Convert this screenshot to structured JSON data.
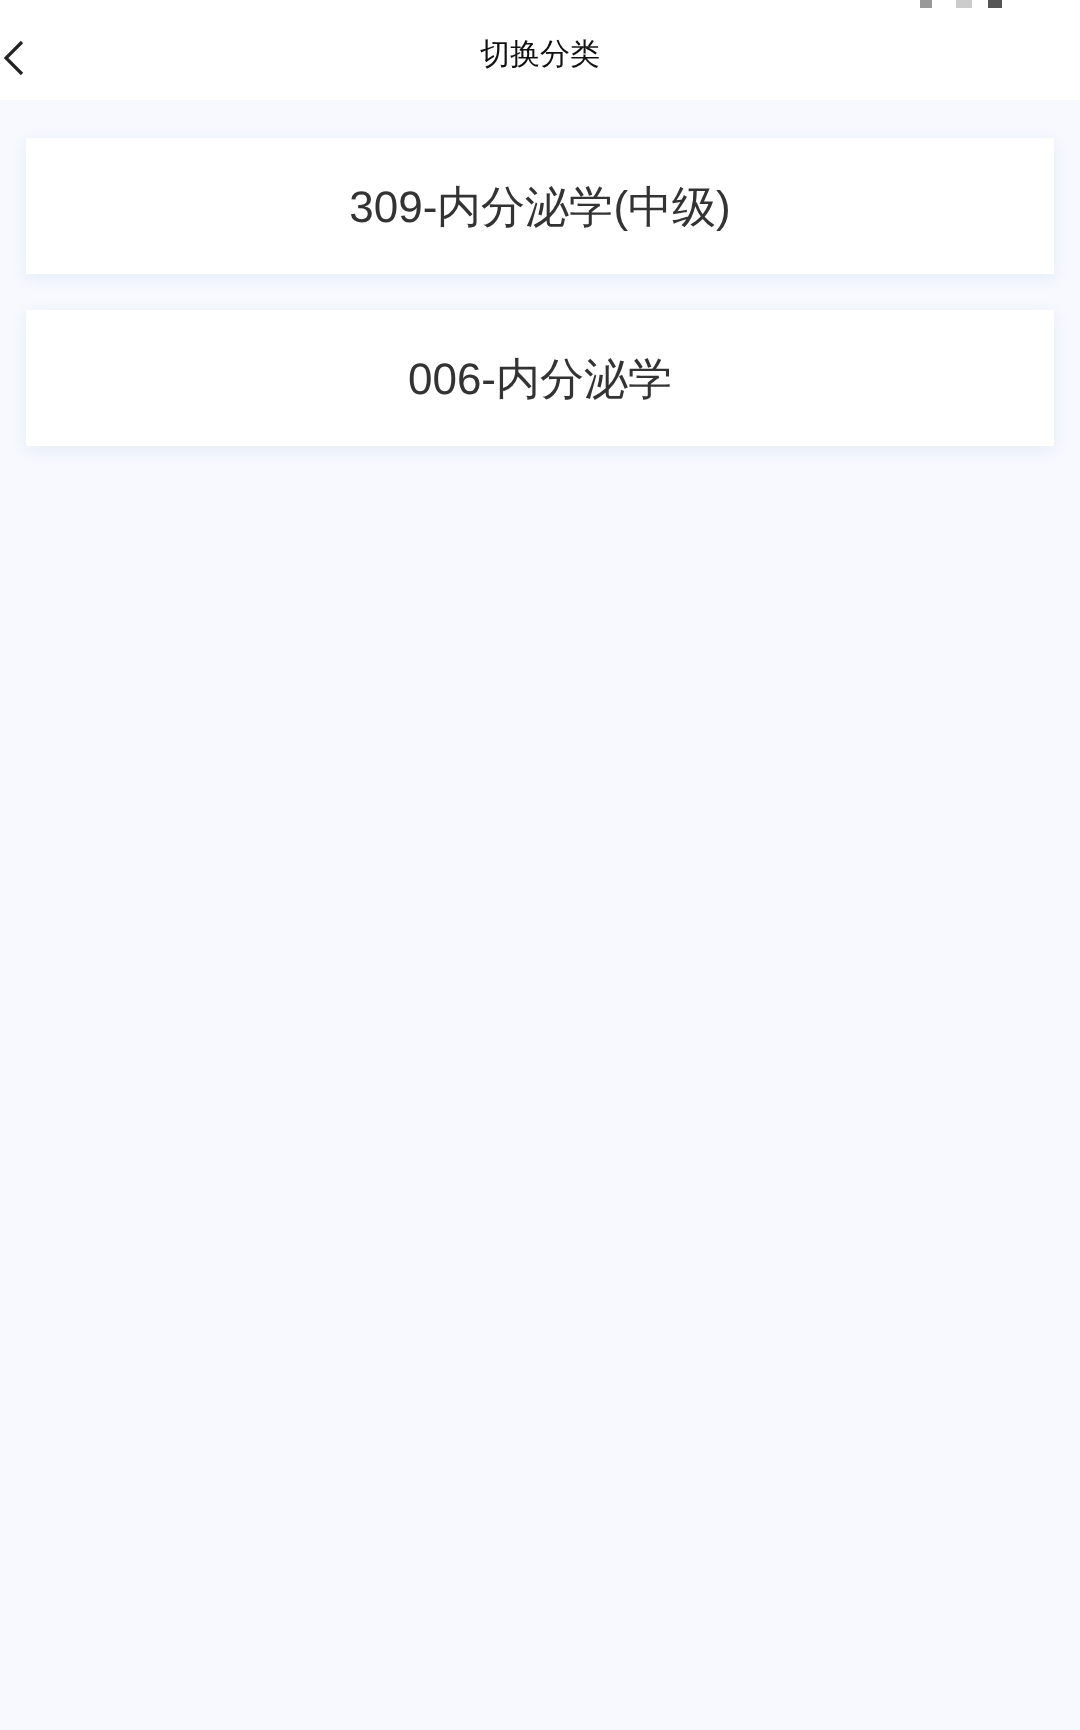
{
  "header": {
    "title": "切换分类"
  },
  "categories": [
    {
      "label": "309-内分泌学(中级)"
    },
    {
      "label": "006-内分泌学"
    }
  ]
}
